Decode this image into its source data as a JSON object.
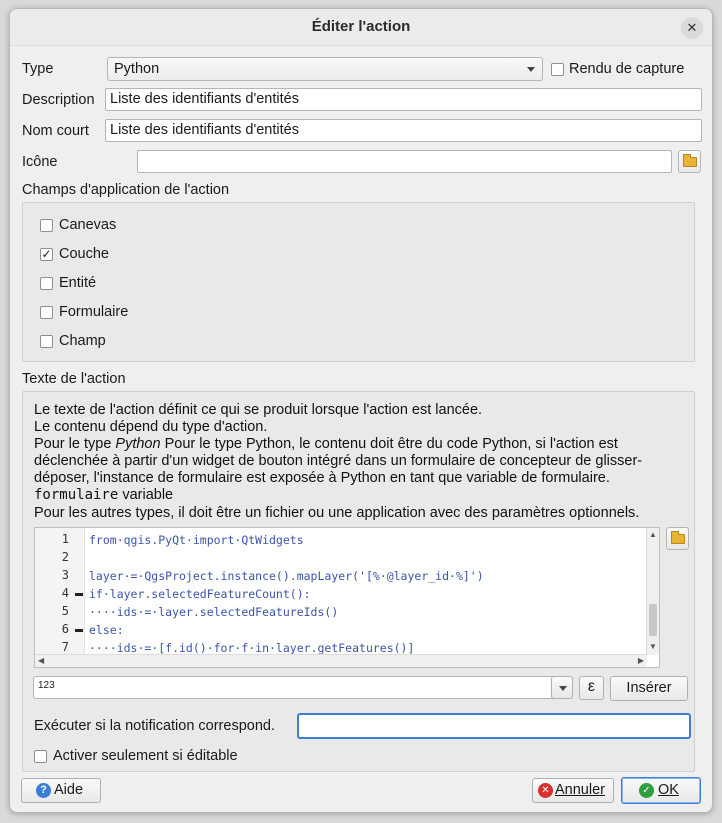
{
  "window": {
    "title": "Éditer l'action"
  },
  "form": {
    "type_label": "Type",
    "type_value": "Python",
    "capture_label": "Rendu de capture",
    "description_label": "Description",
    "description_value": "Liste des identifiants d'entités",
    "shortname_label": "Nom court",
    "shortname_value": "Liste des identifiants d'entités",
    "icon_label": "Icône",
    "icon_value": ""
  },
  "scopes": {
    "title": "Champs d'application de l'action",
    "items": [
      {
        "label": "Canevas",
        "checked": false
      },
      {
        "label": "Couche",
        "checked": true
      },
      {
        "label": "Entité",
        "checked": false
      },
      {
        "label": "Formulaire",
        "checked": false
      },
      {
        "label": "Champ",
        "checked": false
      }
    ]
  },
  "action_text": {
    "title": "Texte de l'action",
    "line1": "Le texte de l'action définit ce qui se produit lorsque l'action est lancée.",
    "line2": "Le contenu dépend du type d'action.",
    "line3_prefix": "Pour le type ",
    "line3_italic": "Python",
    "line3_rest": " Pour le type Python, le contenu doit être du code Python, si l'action est",
    "line4": "déclenchée à partir d'un widget de bouton intégré dans un formulaire de concepteur de glisser-",
    "line5": "déposer, l'instance de formulaire est exposée à Python en tant que variable de formulaire.",
    "line6_mono": "formulaire",
    "line6_rest": " variable",
    "line7": "Pour les autres types, il doit être un fichier ou une application avec des paramètres optionnels."
  },
  "code": {
    "line_numbers": [
      "1",
      "2",
      "3",
      "4",
      "5",
      "6",
      "7"
    ],
    "lines": [
      "from·qgis.PyQt·import·QtWidgets",
      "",
      "layer·=·QgsProject.instance().mapLayer('[%·@layer_id·%]')",
      "if·layer.selectedFeatureCount():",
      "····ids·=·layer.selectedFeatureIds()",
      "else:",
      "····ids·=·[f.id()·for·f·in·layer.getFeatures()]"
    ]
  },
  "expression": {
    "combo_value": "123",
    "epsilon_symbol": "ε",
    "insert_label": "Insérer"
  },
  "notification": {
    "label": "Exécuter si la notification correspond.",
    "value": ""
  },
  "editable_only": {
    "label": "Activer seulement si éditable",
    "checked": false
  },
  "buttons": {
    "help": "Aide",
    "cancel": "Annuler",
    "ok": "OK"
  },
  "colors": {
    "accent": "#3c7fd6",
    "ok_icon": "#2e9e3f",
    "cancel_icon": "#d93030",
    "help_icon": "#3a7dd8"
  }
}
